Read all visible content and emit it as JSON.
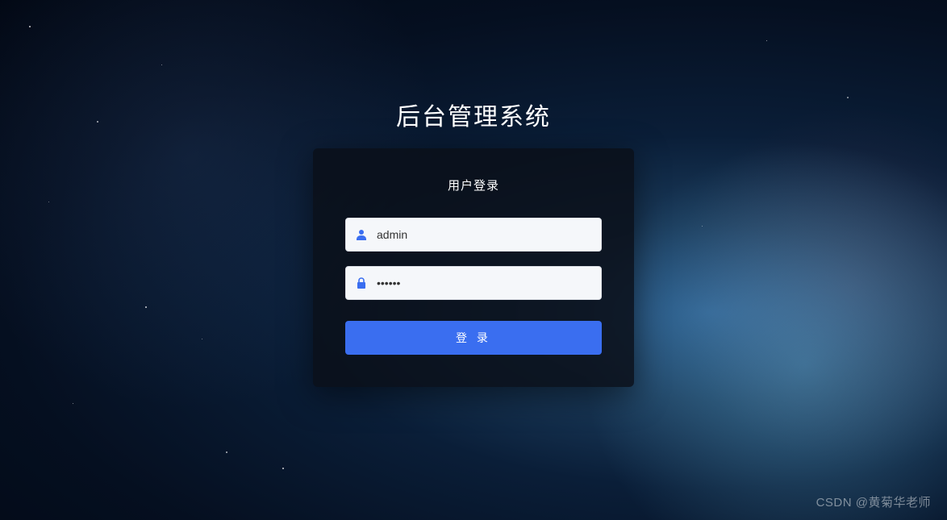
{
  "title": "后台管理系统",
  "card": {
    "heading": "用户登录"
  },
  "form": {
    "username": {
      "value": "admin",
      "placeholder": ""
    },
    "password": {
      "value": "••••••",
      "placeholder": ""
    },
    "submit_label": "登 录"
  },
  "icons": {
    "user": "user-icon",
    "lock": "lock-icon"
  },
  "colors": {
    "primary": "#3a6ef0",
    "icon": "#3a6ef0"
  },
  "watermark": "CSDN @黄菊华老师"
}
